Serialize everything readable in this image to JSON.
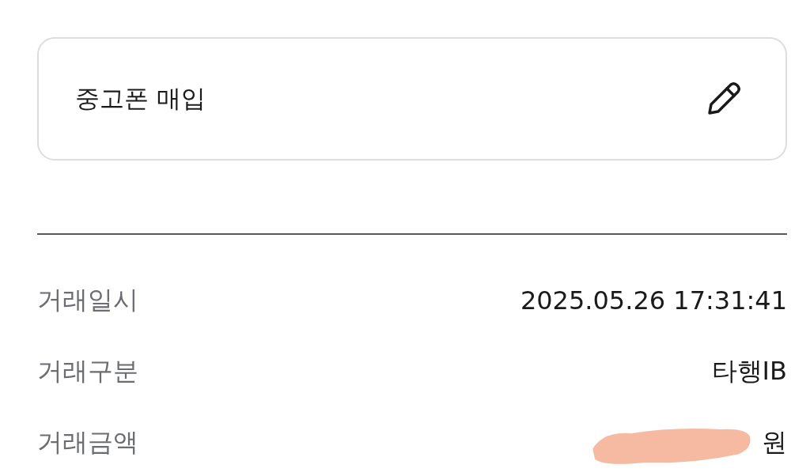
{
  "memo": {
    "text": "중고폰 매입"
  },
  "details": [
    {
      "label": "거래일시",
      "value": "2025.05.26 17:31:41",
      "redacted": false
    },
    {
      "label": "거래구분",
      "value": "타행IB",
      "redacted": false
    },
    {
      "label": "거래금액",
      "value": "원",
      "redacted": true
    }
  ]
}
